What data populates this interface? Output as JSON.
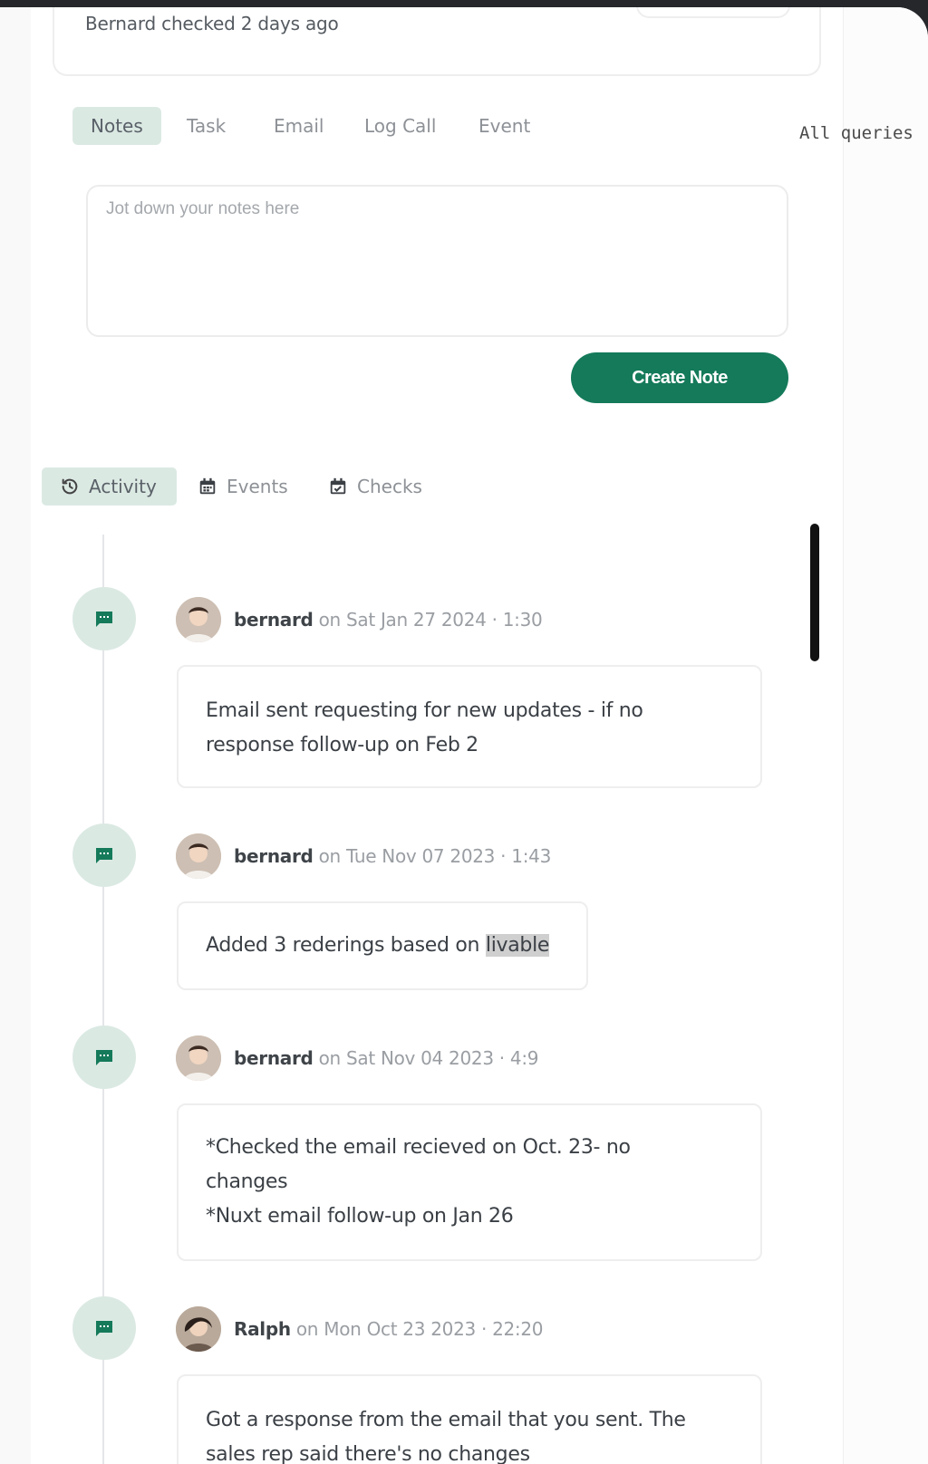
{
  "status": {
    "checked_text": "Bernard checked 2 days ago"
  },
  "side_panel": {
    "queries_text": "All queries"
  },
  "compose": {
    "tabs": [
      "Notes",
      "Task",
      "Email",
      "Log Call",
      "Event"
    ],
    "active_tab": "Notes",
    "placeholder": "Jot down your notes here",
    "value": "",
    "submit_label": "Create Note",
    "accent_color": "#147a5a",
    "active_tab_bg": "#dbe9e3"
  },
  "feed": {
    "tabs": [
      {
        "label": "Activity",
        "icon": "history-icon"
      },
      {
        "label": "Events",
        "icon": "calendar-icon"
      },
      {
        "label": "Checks",
        "icon": "calendar-check-icon"
      }
    ],
    "active_tab": "Activity",
    "entries": [
      {
        "author": "bernard",
        "timestamp": "on Sat Jan 27 2024 · 1:30",
        "icon": "message-icon",
        "lines": [
          "Email sent requesting for new updates - if no",
          "response follow-up on Feb 2"
        ]
      },
      {
        "author": "bernard",
        "timestamp": "on Tue Nov 07 2023 · 1:43",
        "icon": "message-icon",
        "text_before": "Added 3 rederings based on ",
        "text_highlight": "livable"
      },
      {
        "author": "bernard",
        "timestamp": "on Sat Nov 04 2023 · 4:9",
        "icon": "message-icon",
        "lines": [
          "*Checked the email recieved on Oct. 23- no",
          "changes",
          "*Nuxt email follow-up on Jan 26"
        ]
      },
      {
        "author": "Ralph",
        "timestamp": "on Mon Oct 23 2023 · 22:20",
        "icon": "message-icon",
        "lines": [
          "Got a response from the email that you sent. The",
          "sales rep said there's no changes"
        ]
      }
    ]
  }
}
